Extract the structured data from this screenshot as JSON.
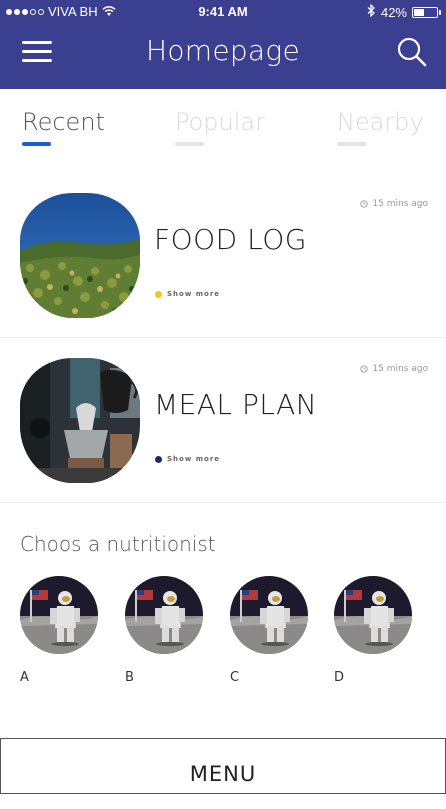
{
  "status_bar": {
    "carrier": "VIVA BH",
    "time": "9:41 AM",
    "battery": "42%",
    "battery_level": 0.42
  },
  "header": {
    "title": "Homepage",
    "background": "#3a3f8f"
  },
  "tabs": [
    {
      "label": "Recent",
      "active": true
    },
    {
      "label": "Popular",
      "active": false
    },
    {
      "label": "Nearby",
      "active": false
    }
  ],
  "cards": [
    {
      "title": "FOOD LOG",
      "time": "15 mins ago",
      "more": "Show more",
      "dot_color": "#f5c518",
      "image": "forest-landscape-photo"
    },
    {
      "title": "MEAL PLAN",
      "time": "15 mins ago",
      "more": "Show more",
      "dot_color": "#1f2b5e",
      "image": "coffee-brewing-photo"
    }
  ],
  "nutritionists": {
    "title": "Choos a nutritionist",
    "items": [
      {
        "label": "A"
      },
      {
        "label": "B"
      },
      {
        "label": "C"
      },
      {
        "label": "D"
      }
    ]
  },
  "bottom": {
    "label": "MENU"
  },
  "colors": {
    "accent": "#1a5fd6",
    "header": "#3a3f8f"
  }
}
